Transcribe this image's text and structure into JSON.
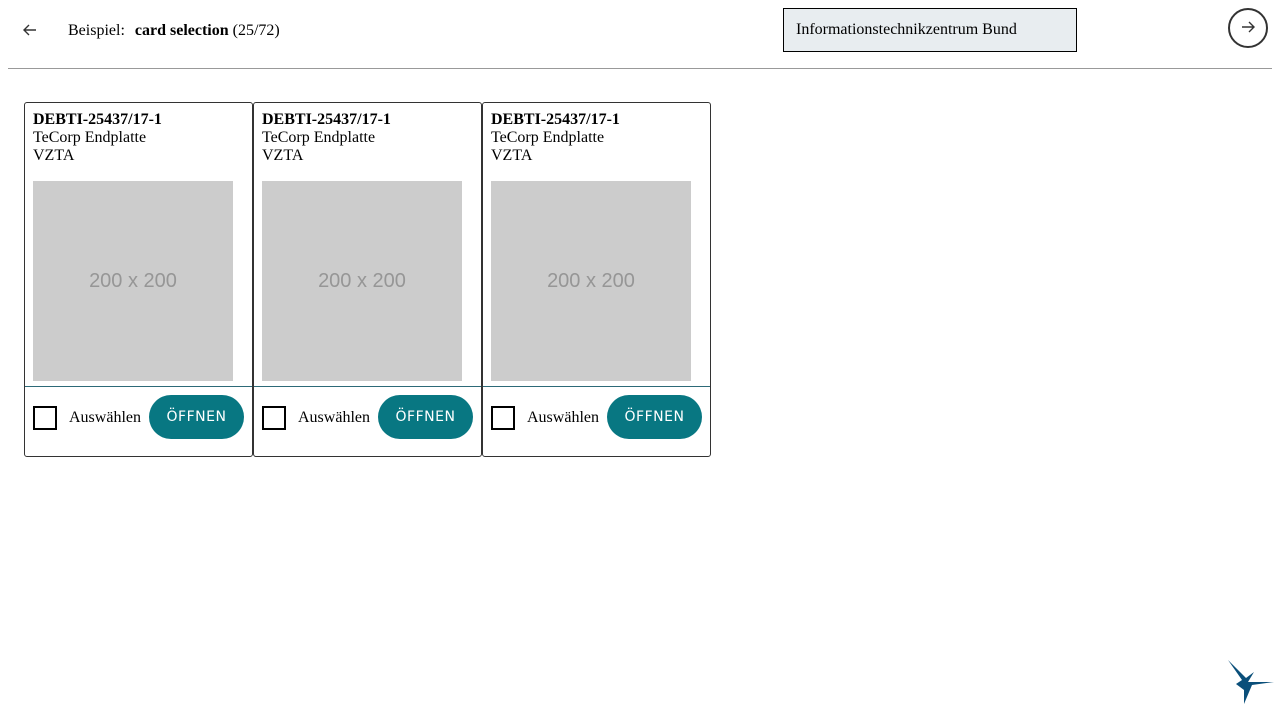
{
  "header": {
    "back_icon": "arrow-left-icon",
    "example_prefix": "Beispiel:",
    "example_name": "card selection",
    "example_count": "(25/72)",
    "theme_select_value": "Informationstechnikzentrum Bund",
    "next_icon": "arrow-right-icon"
  },
  "cards": [
    {
      "id": "DEBTI-25437/17-1",
      "line1": "TeCorp Endplatte",
      "line2": "VZTA",
      "image_label": "200 x 200",
      "select_label": "Auswählen",
      "open_label": "ÖFFNEN"
    },
    {
      "id": "DEBTI-25437/17-1",
      "line1": "TeCorp Endplatte",
      "line2": "VZTA",
      "image_label": "200 x 200",
      "select_label": "Auswählen",
      "open_label": "ÖFFNEN"
    },
    {
      "id": "DEBTI-25437/17-1",
      "line1": "TeCorp Endplatte",
      "line2": "VZTA",
      "image_label": "200 x 200",
      "select_label": "Auswählen",
      "open_label": "ÖFFNEN"
    }
  ],
  "colors": {
    "accent": "#087782",
    "select_background": "#e8edf0",
    "logo": "#0a4f7a",
    "placeholder": "#cccccc"
  },
  "logo_icon": "hummingbird-logo-icon"
}
